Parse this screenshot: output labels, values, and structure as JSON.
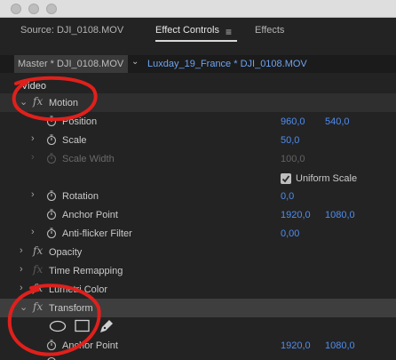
{
  "window": {
    "tabs": [
      {
        "label": "Source: DJI_0108.MOV",
        "active": false
      },
      {
        "label": "Effect Controls",
        "active": true
      },
      {
        "label": "Effects",
        "active": false
      }
    ],
    "menu_icon": "hamburger-menu-icon"
  },
  "clip_selector": {
    "master": "Master * DJI_0108.MOV",
    "clip": "Luxday_19_France * DJI_0108.MOV"
  },
  "section_header": "Video",
  "effects": {
    "motion": {
      "label": "Motion",
      "position": {
        "label": "Position",
        "x": "960,0",
        "y": "540,0"
      },
      "scale": {
        "label": "Scale",
        "value": "50,0"
      },
      "scale_width": {
        "label": "Scale Width",
        "value": "100,0"
      },
      "uniform_scale": {
        "label": "Uniform Scale",
        "checked": true
      },
      "rotation": {
        "label": "Rotation",
        "value": "0,0"
      },
      "anchor_point": {
        "label": "Anchor Point",
        "x": "1920,0",
        "y": "1080,0"
      },
      "anti_flicker": {
        "label": "Anti-flicker Filter",
        "value": "0,00"
      }
    },
    "opacity": {
      "label": "Opacity"
    },
    "time_remapping": {
      "label": "Time Remapping"
    },
    "lumetri": {
      "label": "Lumetri Color"
    },
    "transform": {
      "label": "Transform",
      "mask_tools": [
        "ellipse-mask-icon",
        "rectangle-mask-icon",
        "pen-mask-icon"
      ],
      "anchor_point": {
        "label": "Anchor Point",
        "x": "1920,0",
        "y": "1080,0"
      }
    }
  },
  "colors": {
    "panel_bg": "#232323",
    "value_blue": "#4f8df0",
    "annotation_red": "#e0201c"
  }
}
